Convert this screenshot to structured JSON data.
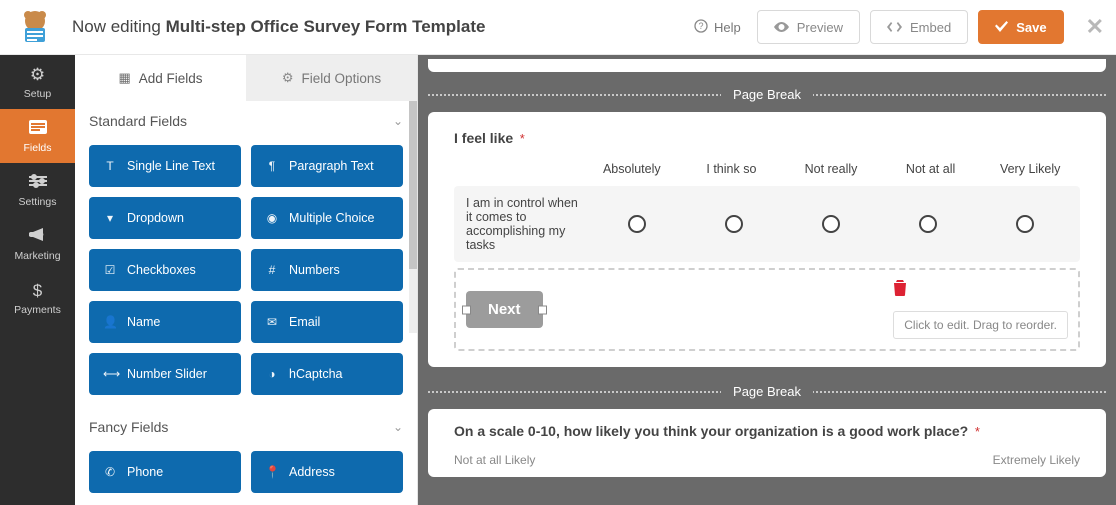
{
  "header": {
    "prefix": "Now editing",
    "title": "Multi-step Office Survey Form Template",
    "help": "Help",
    "preview": "Preview",
    "embed": "Embed",
    "save": "Save"
  },
  "vnav": {
    "setup": "Setup",
    "fields": "Fields",
    "settings": "Settings",
    "marketing": "Marketing",
    "payments": "Payments"
  },
  "tabs": {
    "add_fields": "Add Fields",
    "field_options": "Field Options"
  },
  "groups": {
    "standard": "Standard Fields",
    "fancy": "Fancy Fields"
  },
  "fields": {
    "single_line_text": "Single Line Text",
    "paragraph_text": "Paragraph Text",
    "dropdown": "Dropdown",
    "multiple_choice": "Multiple Choice",
    "checkboxes": "Checkboxes",
    "numbers": "Numbers",
    "name": "Name",
    "email": "Email",
    "number_slider": "Number Slider",
    "hcaptcha": "hCaptcha",
    "phone": "Phone",
    "address": "Address"
  },
  "canvas": {
    "page_break": "Page Break",
    "q1_label": "I feel like",
    "required_marker": "*",
    "columns": [
      "Absolutely",
      "I think so",
      "Not really",
      "Not at all",
      "Very Likely"
    ],
    "row1": "I am in control when it comes to accomplishing my tasks",
    "next_label": "Next",
    "hint": "Click to edit. Drag to reorder.",
    "q2_label": "On a scale 0-10, how likely you think your organization is a good work place?",
    "scale_low": "Not at all Likely",
    "scale_high": "Extremely Likely"
  }
}
